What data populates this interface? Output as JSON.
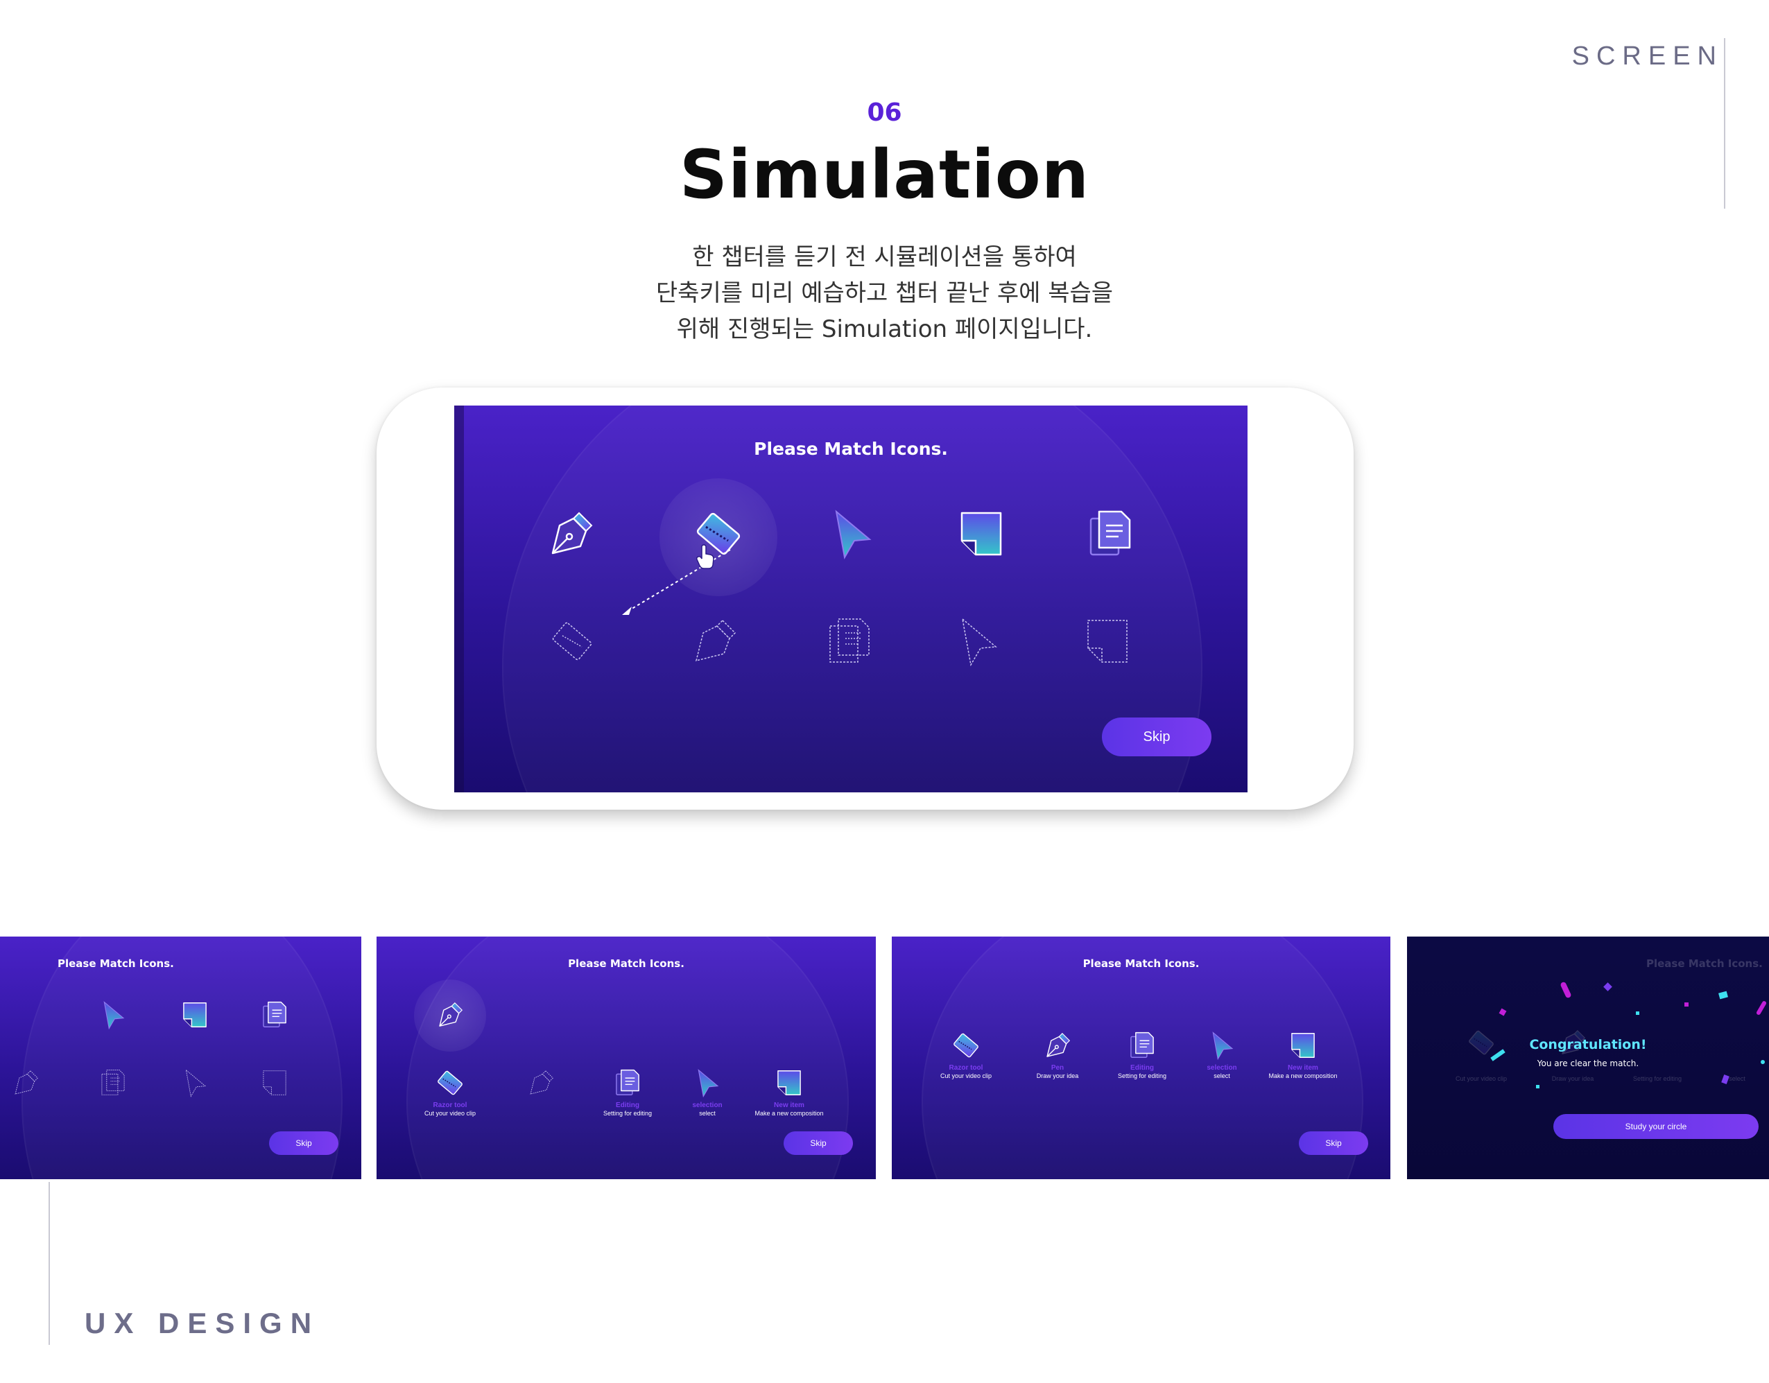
{
  "corner": {
    "top_right": "SCREEN",
    "bottom_left": "UX  DESIGN"
  },
  "section": {
    "number": "06",
    "title": "Simulation",
    "description": [
      "한 챕터를 듣기 전 시뮬레이션을 통하여",
      "단축키를 미리 예습하고 챕터 끝난 후에 복습을",
      "위해 진행되는 Simulation 페이지입니다."
    ]
  },
  "simulation": {
    "prompt": "Please Match Icons.",
    "skip_label": "Skip",
    "top_icons": [
      "pen-tool-icon",
      "razor-tool-icon",
      "selection-arrow-icon",
      "new-item-icon",
      "editing-icon"
    ],
    "bottom_outlines": [
      "razor-outline-icon",
      "pen-outline-icon",
      "editing-outline-icon",
      "selection-outline-icon",
      "new-item-outline-icon"
    ]
  },
  "steps": [
    {
      "prompt": "Please Match Icons.",
      "skip_label": "Skip"
    },
    {
      "prompt": "Please Match Icons.",
      "skip_label": "Skip",
      "matched": [
        {
          "name": "Razor tool",
          "desc": "Cut your video clip"
        },
        {
          "name": "Editing",
          "desc": "Setting for editing"
        },
        {
          "name": "selection",
          "desc": "select"
        },
        {
          "name": "New item",
          "desc": "Make a new composition"
        }
      ]
    },
    {
      "prompt": "Please Match Icons.",
      "skip_label": "Skip",
      "matched": [
        {
          "name": "Razor tool",
          "desc": "Cut your video clip"
        },
        {
          "name": "Pen",
          "desc": "Draw your idea"
        },
        {
          "name": "Editing",
          "desc": "Setting for editing"
        },
        {
          "name": "selection",
          "desc": "select"
        },
        {
          "name": "New item",
          "desc": "Make a new composition"
        }
      ]
    },
    {
      "prompt": "Please Match Icons.",
      "congrats_title": "Congratulation!",
      "congrats_sub": "You are clear the match.",
      "study_label": "Study your circle",
      "faded_captions": [
        "Cut your video clip",
        "Draw your idea",
        "Setting for editing",
        "select"
      ]
    }
  ],
  "colors": {
    "accent": "#5a22d8",
    "screen_top": "#4a22c8",
    "screen_bottom": "#1a0c70",
    "caption": "#7b3df0",
    "congrats": "#5fe6ff"
  }
}
